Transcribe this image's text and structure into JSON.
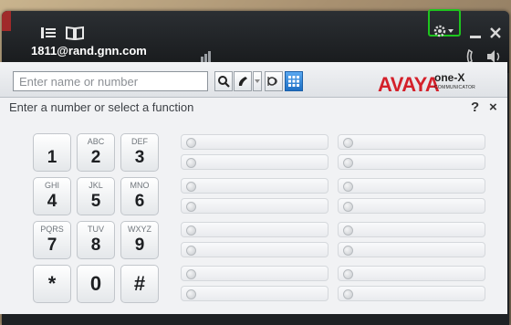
{
  "titlebar": {
    "account": "1811@rand.gnn.com",
    "icons": [
      "contacts-list-icon",
      "directory-book-icon",
      "signal-bars-icon",
      "settings-gear-icon",
      "minimize-icon",
      "close-icon",
      "phone-handset-icon",
      "speaker-icon"
    ]
  },
  "search": {
    "placeholder": "Enter name or number",
    "buttons": [
      "search-icon",
      "call-icon",
      "dropdown-arrow-icon",
      "voicemail-icon",
      "dialpad-icon"
    ]
  },
  "brand": {
    "logo": "AVAYA",
    "product": "one-X",
    "subtitle": "COMMUNICATOR"
  },
  "panel": {
    "header": "Enter a number or select a function",
    "help": "?",
    "close": "×"
  },
  "keypad": [
    {
      "num": "1",
      "sub": ""
    },
    {
      "num": "2",
      "sub": "ABC"
    },
    {
      "num": "3",
      "sub": "DEF"
    },
    {
      "num": "4",
      "sub": "GHI"
    },
    {
      "num": "5",
      "sub": "JKL"
    },
    {
      "num": "6",
      "sub": "MNO"
    },
    {
      "num": "7",
      "sub": "PQRS"
    },
    {
      "num": "8",
      "sub": "TUV"
    },
    {
      "num": "9",
      "sub": "WXYZ"
    },
    {
      "num": "*",
      "sub": ""
    },
    {
      "num": "0",
      "sub": ""
    },
    {
      "num": "#",
      "sub": ""
    }
  ],
  "colors": {
    "highlight": "#1ec51e",
    "brand_red": "#d4202a"
  }
}
